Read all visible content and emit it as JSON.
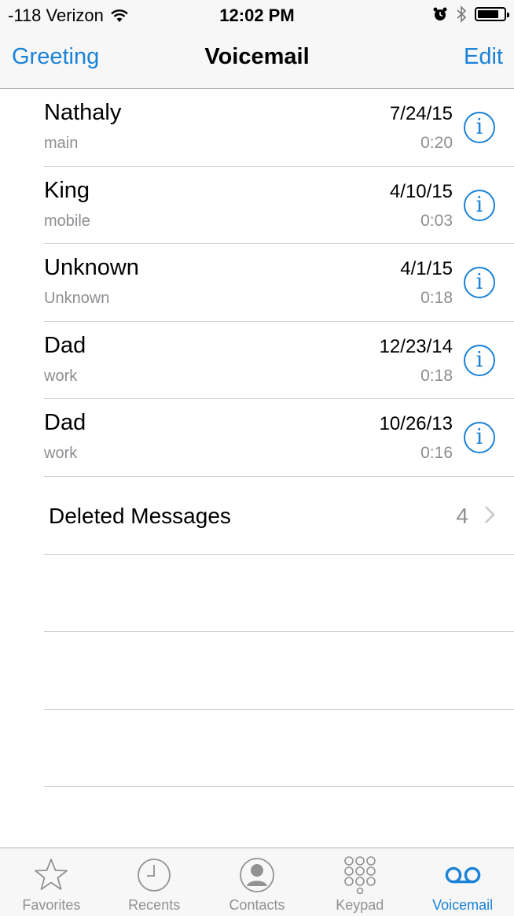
{
  "status_bar": {
    "carrier": "-118 Verizon",
    "time": "12:02 PM",
    "battery_level": 0.8
  },
  "nav": {
    "left_label": "Greeting",
    "title": "Voicemail",
    "right_label": "Edit"
  },
  "voicemails": [
    {
      "name": "Nathaly",
      "label": "main",
      "date": "7/24/15",
      "duration": "0:20"
    },
    {
      "name": "King",
      "label": "mobile",
      "date": "4/10/15",
      "duration": "0:03"
    },
    {
      "name": "Unknown",
      "label": "Unknown",
      "date": "4/1/15",
      "duration": "0:18"
    },
    {
      "name": "Dad",
      "label": "work",
      "date": "12/23/14",
      "duration": "0:18"
    },
    {
      "name": "Dad",
      "label": "work",
      "date": "10/26/13",
      "duration": "0:16"
    }
  ],
  "deleted": {
    "label": "Deleted Messages",
    "count": "4"
  },
  "tabs": [
    {
      "label": "Favorites",
      "icon": "star-icon"
    },
    {
      "label": "Recents",
      "icon": "clock-icon"
    },
    {
      "label": "Contacts",
      "icon": "person-icon"
    },
    {
      "label": "Keypad",
      "icon": "keypad-icon"
    },
    {
      "label": "Voicemail",
      "icon": "voicemail-icon",
      "active": true
    }
  ],
  "colors": {
    "accent": "#1a82d7",
    "secondary_text": "#8e8e93",
    "tab_inactive": "#929292"
  }
}
